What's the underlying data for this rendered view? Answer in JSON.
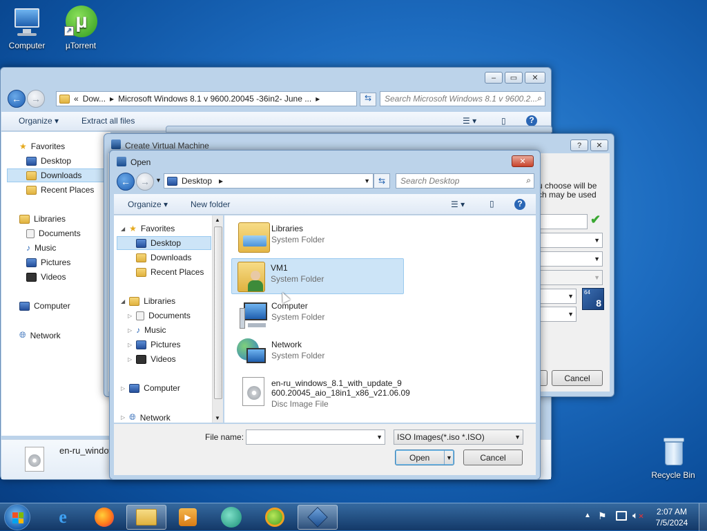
{
  "desktop": {
    "icons": [
      {
        "label": "Computer"
      },
      {
        "label": "µTorrent"
      },
      {
        "label": "Recycle Bin"
      }
    ]
  },
  "explorer": {
    "breadcrumb_prefix": "«",
    "breadcrumb_1": "Dow...",
    "breadcrumb_2": "Microsoft Windows 8.1 v 9600.20045 -36in2- June ...",
    "search_placeholder": "Search Microsoft Windows 8.1 v 9600.2...",
    "toolbar": {
      "organize": "Organize",
      "extract": "Extract all files"
    },
    "nav": {
      "favorites": "Favorites",
      "desktop": "Desktop",
      "downloads": "Downloads",
      "recent": "Recent Places",
      "libraries": "Libraries",
      "documents": "Documents",
      "music": "Music",
      "pictures": "Pictures",
      "videos": "Videos",
      "computer": "Computer",
      "network": "Network"
    },
    "bottom_file": "en-ru_window"
  },
  "vm_dialog": {
    "title": "Create Virtual Machine",
    "text_line1": "u choose will be",
    "text_line2": "ch may be used",
    "cancel": "Cancel",
    "badge_64": "64",
    "badge_8": "8"
  },
  "open_dialog": {
    "title": "Open",
    "address": "Desktop",
    "search_placeholder": "Search Desktop",
    "toolbar": {
      "organize": "Organize",
      "new_folder": "New folder"
    },
    "nav": {
      "favorites": "Favorites",
      "desktop": "Desktop",
      "downloads": "Downloads",
      "recent": "Recent Places",
      "libraries": "Libraries",
      "documents": "Documents",
      "music": "Music",
      "pictures": "Pictures",
      "videos": "Videos",
      "computer": "Computer",
      "network": "Network"
    },
    "files": [
      {
        "name": "Libraries",
        "type": "System Folder"
      },
      {
        "name": "VM1",
        "type": "System Folder"
      },
      {
        "name": "Computer",
        "type": "System Folder"
      },
      {
        "name": "Network",
        "type": "System Folder"
      },
      {
        "name": "en-ru_windows_8.1_with_update_9",
        "name2": "600.20045_aio_18in1_x86_v21.06.09",
        "type": "Disc Image File"
      }
    ],
    "file_name_label": "File name:",
    "file_name_value": "",
    "filter": "ISO Images(*.iso *.ISO)",
    "open": "Open",
    "cancel": "Cancel"
  },
  "taskbar": {
    "time": "2:07 AM",
    "date": "7/5/2024"
  },
  "colors": {
    "accent": "#1d6cc0",
    "selection": "#cce4f7"
  }
}
